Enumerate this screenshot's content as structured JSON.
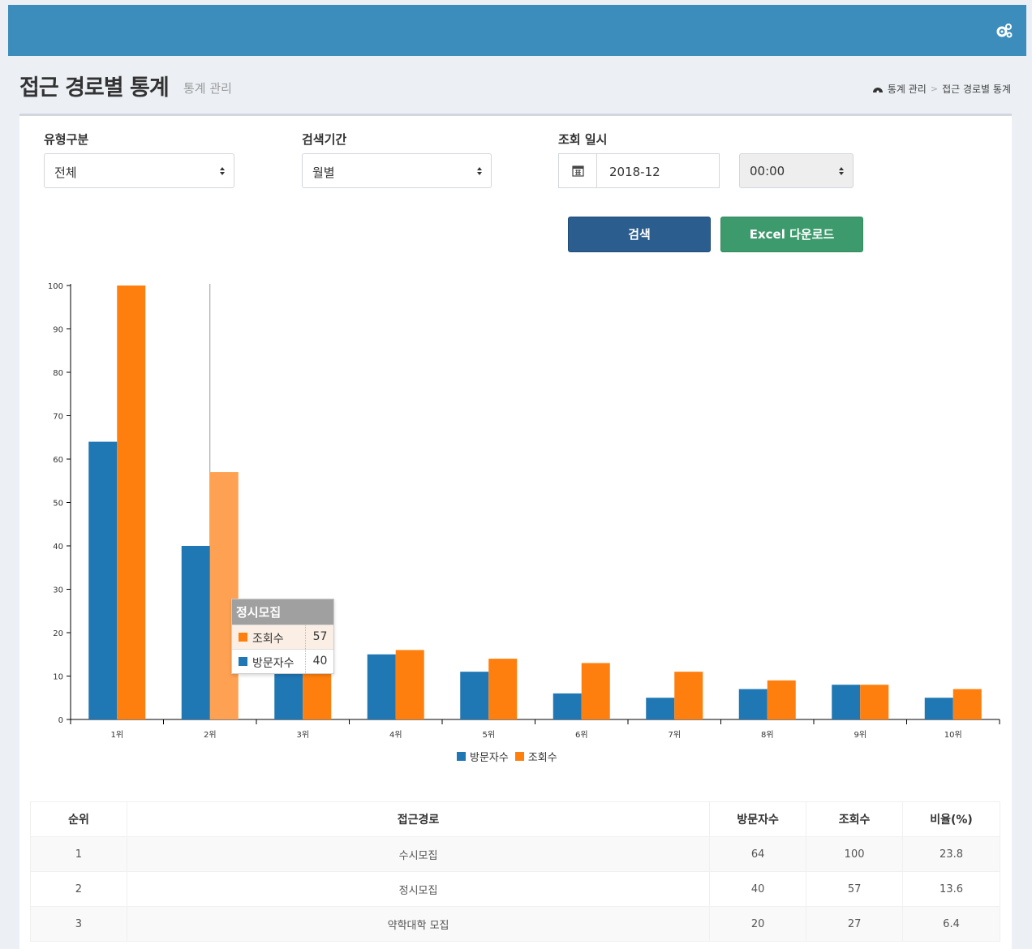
{
  "header": {
    "gear_icon": "gears-icon"
  },
  "page": {
    "title": "접근 경로별 통계",
    "subtitle": "통계 관리",
    "breadcrumb": {
      "home": "통계 관리",
      "sep": ">",
      "current": "접근 경로별 통계"
    }
  },
  "filters": {
    "type_label": "유형구분",
    "type_value": "전체",
    "period_label": "검색기간",
    "period_value": "월별",
    "date_label": "조회 일시",
    "date_value": "2018-12",
    "time_value": "00:00"
  },
  "buttons": {
    "search": "검색",
    "excel": "Excel 다운로드"
  },
  "colors": {
    "visitors": "#1f77b4",
    "views": "#ff7f0e",
    "views_highlight": "#ffa152"
  },
  "chart_data": {
    "type": "bar",
    "categories": [
      "1위",
      "2위",
      "3위",
      "4위",
      "5위",
      "6위",
      "7위",
      "8위",
      "9위",
      "10위"
    ],
    "series": [
      {
        "name": "방문자수",
        "values": [
          64,
          40,
          20,
          15,
          11,
          6,
          5,
          7,
          8,
          5
        ]
      },
      {
        "name": "조회수",
        "values": [
          100,
          57,
          27,
          16,
          14,
          13,
          11,
          9,
          8,
          7
        ]
      }
    ],
    "yticks": [
      0,
      10,
      20,
      30,
      40,
      50,
      60,
      70,
      80,
      90,
      100
    ],
    "ylim": [
      0,
      100
    ],
    "legend": "bottom",
    "grid": false
  },
  "tooltip": {
    "title": "정시모집",
    "rows": [
      {
        "name": "조회수",
        "value": "57"
      },
      {
        "name": "방문자수",
        "value": "40"
      }
    ]
  },
  "table": {
    "headers": [
      "순위",
      "접근경로",
      "방문자수",
      "조회수",
      "비율(%)"
    ],
    "rows": [
      [
        "1",
        "수시모집",
        "64",
        "100",
        "23.8"
      ],
      [
        "2",
        "정시모집",
        "40",
        "57",
        "13.6"
      ],
      [
        "3",
        "약학대학 모집",
        "20",
        "27",
        "6.4"
      ]
    ]
  }
}
